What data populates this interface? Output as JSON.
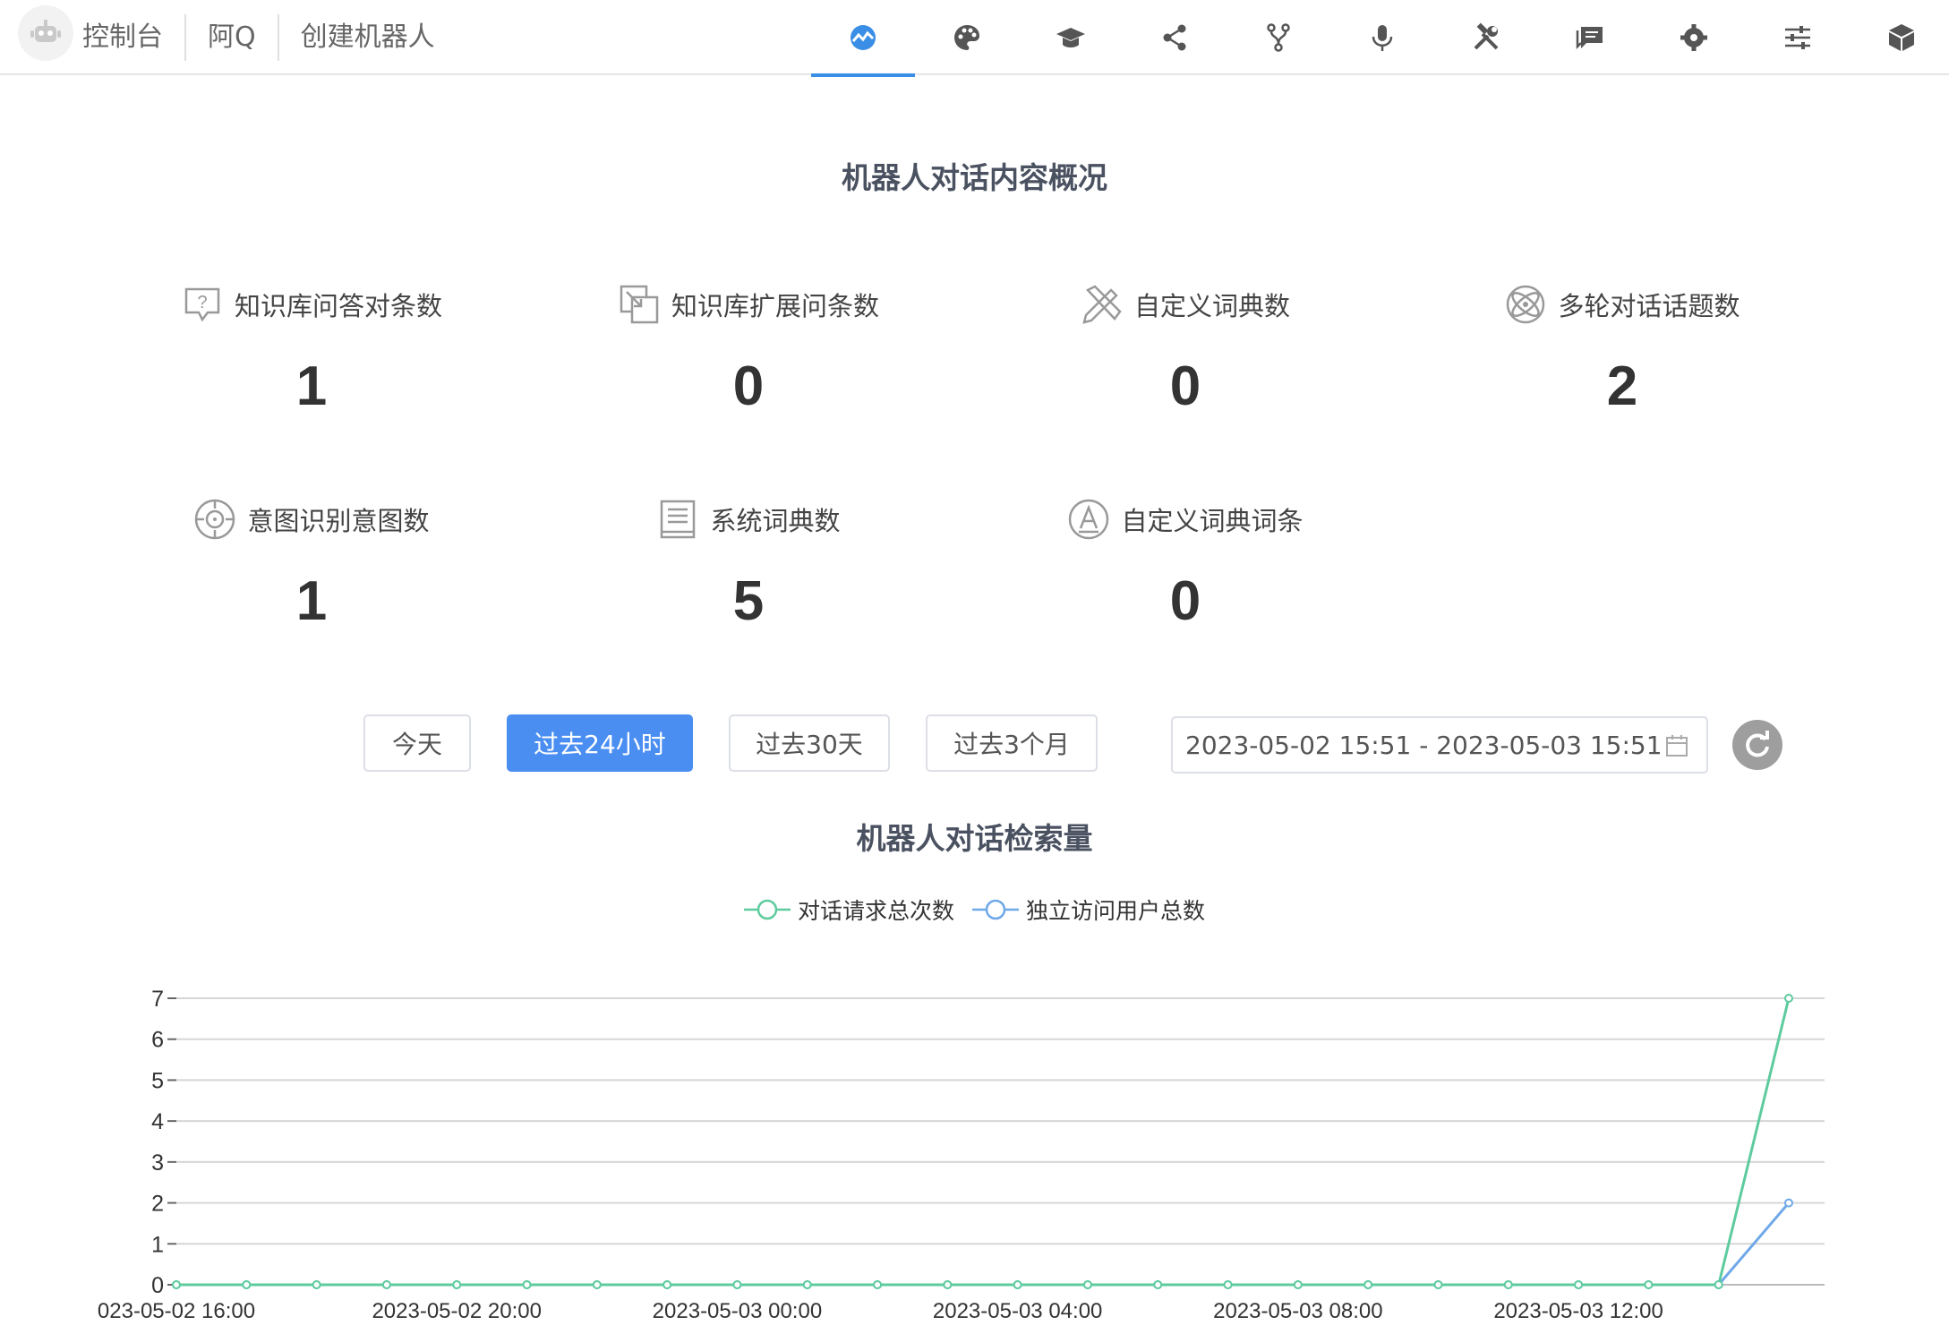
{
  "nav": {
    "breadcrumbs": [
      "控制台",
      "阿Q",
      "创建机器人"
    ],
    "icons": [
      "overview-icon",
      "palette-icon",
      "graduation-cap-icon",
      "share-icon",
      "fork-icon",
      "microphone-icon",
      "tools-icon",
      "chat-icon",
      "gear-icon",
      "sliders-icon",
      "cube-icon"
    ],
    "active_icon": "overview-icon",
    "accent_color": "#3a8ee6"
  },
  "overview": {
    "title": "机器人对话内容概况",
    "stats": [
      {
        "label": "知识库问答对条数",
        "value": "1",
        "icon": "question-bubble-icon"
      },
      {
        "label": "知识库扩展问条数",
        "value": "0",
        "icon": "expand-icon"
      },
      {
        "label": "自定义词典数",
        "value": "0",
        "icon": "pencil-ruler-icon"
      },
      {
        "label": "多轮对话话题数",
        "value": "2",
        "icon": "atom-icon"
      },
      {
        "label": "意图识别意图数",
        "value": "1",
        "icon": "crosshair-icon"
      },
      {
        "label": "系统词典数",
        "value": "5",
        "icon": "book-icon"
      },
      {
        "label": "自定义词典词条",
        "value": "0",
        "icon": "letter-a-icon"
      }
    ]
  },
  "filters": {
    "buttons": [
      "今天",
      "过去24小时",
      "过去30天",
      "过去3个月"
    ],
    "active": "过去24小时",
    "date_range": "2023-05-02 15:51 - 2023-05-03 15:51"
  },
  "chart_title": "机器人对话检索量",
  "chart_data": {
    "type": "line",
    "x": [
      "2023-05-02 16:00",
      "2023-05-02 17:00",
      "2023-05-02 18:00",
      "2023-05-02 19:00",
      "2023-05-02 20:00",
      "2023-05-02 21:00",
      "2023-05-02 22:00",
      "2023-05-02 23:00",
      "2023-05-03 00:00",
      "2023-05-03 01:00",
      "2023-05-03 02:00",
      "2023-05-03 03:00",
      "2023-05-03 04:00",
      "2023-05-03 05:00",
      "2023-05-03 06:00",
      "2023-05-03 07:00",
      "2023-05-03 08:00",
      "2023-05-03 09:00",
      "2023-05-03 10:00",
      "2023-05-03 11:00",
      "2023-05-03 12:00",
      "2023-05-03 13:00",
      "2023-05-03 14:00",
      "2023-05-03 15:00"
    ],
    "x_tick_labels": [
      "023-05-02 16:00",
      "2023-05-02 20:00",
      "2023-05-03 00:00",
      "2023-05-03 04:00",
      "2023-05-03 08:00",
      "2023-05-03 12:00"
    ],
    "series": [
      {
        "name": "对话请求总次数",
        "color": "#5ecb9e",
        "values": [
          0,
          0,
          0,
          0,
          0,
          0,
          0,
          0,
          0,
          0,
          0,
          0,
          0,
          0,
          0,
          0,
          0,
          0,
          0,
          0,
          0,
          0,
          0,
          7
        ]
      },
      {
        "name": "独立访问用户总数",
        "color": "#6fa8e8",
        "values": [
          0,
          0,
          0,
          0,
          0,
          0,
          0,
          0,
          0,
          0,
          0,
          0,
          0,
          0,
          0,
          0,
          0,
          0,
          0,
          0,
          0,
          0,
          0,
          2
        ]
      }
    ],
    "ylim": [
      0,
      7
    ],
    "yticks": [
      "0",
      "1",
      "2",
      "3",
      "4",
      "5",
      "6",
      "7"
    ],
    "grid": true,
    "legend": "top-center"
  }
}
